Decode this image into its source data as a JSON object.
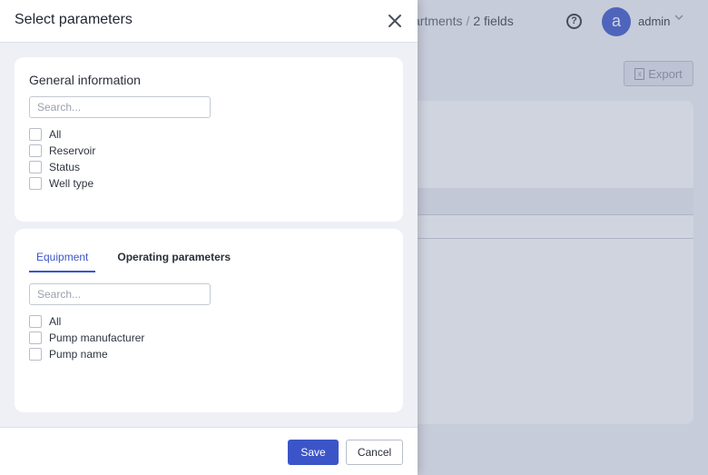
{
  "background": {
    "breadcrumb_prev": "artments",
    "breadcrumb_sep": "/",
    "breadcrumb_current": "2 fields",
    "user_initial": "a",
    "user_name": "admin",
    "export_label": "Export"
  },
  "modal": {
    "title": "Select parameters",
    "general": {
      "title": "General information",
      "search_placeholder": "Search...",
      "items": [
        "All",
        "Reservoir",
        "Status",
        "Well type"
      ]
    },
    "tabs": [
      "Equipment",
      "Operating parameters"
    ],
    "equipment": {
      "search_placeholder": "Search...",
      "items": [
        "All",
        "Pump manufacturer",
        "Pump name"
      ]
    },
    "save_label": "Save",
    "cancel_label": "Cancel"
  },
  "colors": {
    "accent": "#3b55c8"
  }
}
